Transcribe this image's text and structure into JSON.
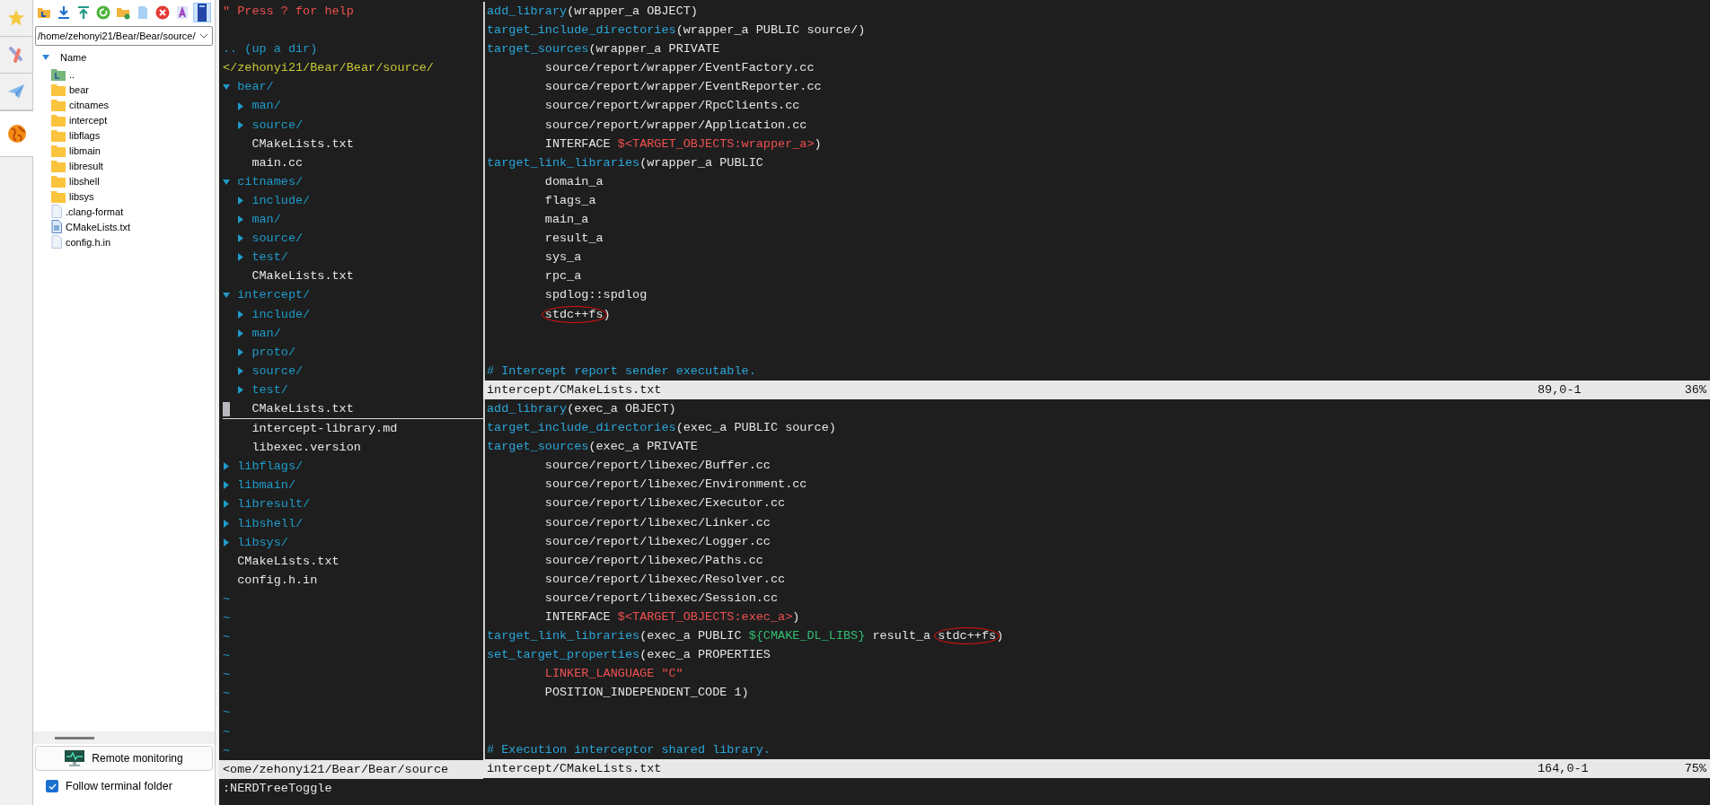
{
  "sidebar": {
    "tabs": [
      {
        "kind": "star",
        "selected": false
      },
      {
        "kind": "tool",
        "selected": false
      },
      {
        "kind": "plane",
        "selected": false
      },
      {
        "kind": "globe",
        "selected": true
      }
    ],
    "toolbar": [
      {
        "kind": "folder-up",
        "on": false
      },
      {
        "kind": "download",
        "on": false
      },
      {
        "kind": "upload",
        "on": false
      },
      {
        "kind": "refresh",
        "on": false
      },
      {
        "kind": "new-folder",
        "on": false
      },
      {
        "kind": "new-file",
        "on": false
      },
      {
        "kind": "close",
        "on": false
      },
      {
        "kind": "font",
        "on": false
      },
      {
        "kind": "panel",
        "on": true
      }
    ],
    "path": "/home/zehonyi21/Bear/Bear/source/",
    "files": {
      "header": "Name",
      "items": [
        {
          "kind": "up",
          "name": ".."
        },
        {
          "kind": "folder",
          "name": "bear"
        },
        {
          "kind": "folder",
          "name": "citnames"
        },
        {
          "kind": "folder",
          "name": "intercept"
        },
        {
          "kind": "folder",
          "name": "libflags"
        },
        {
          "kind": "folder",
          "name": "libmain"
        },
        {
          "kind": "folder",
          "name": "libresult"
        },
        {
          "kind": "folder",
          "name": "libshell"
        },
        {
          "kind": "folder",
          "name": "libsys"
        },
        {
          "kind": "file",
          "name": ".clang-format"
        },
        {
          "kind": "text",
          "name": "CMakeLists.txt"
        },
        {
          "kind": "file",
          "name": "config.h.in"
        }
      ]
    },
    "remote_button": "Remote monitoring",
    "follow": {
      "label": "Follow terminal folder",
      "checked": true
    }
  },
  "vim": {
    "tree": {
      "help": "\" Press ? for help",
      "up": ".. (up a dir)",
      "root": "</zehonyi21/Bear/Bear/source/",
      "entries": [
        {
          "kind": "dir",
          "name": "bear/",
          "expanded": true,
          "children": [
            {
              "kind": "dir",
              "name": "man/",
              "expanded": false
            },
            {
              "kind": "dir",
              "name": "source/",
              "expanded": false
            },
            {
              "kind": "file",
              "name": "CMakeLists.txt"
            },
            {
              "kind": "file",
              "name": "main.cc"
            }
          ]
        },
        {
          "kind": "dir",
          "name": "citnames/",
          "expanded": true,
          "children": [
            {
              "kind": "dir",
              "name": "include/",
              "expanded": false
            },
            {
              "kind": "dir",
              "name": "man/",
              "expanded": false
            },
            {
              "kind": "dir",
              "name": "source/",
              "expanded": false
            },
            {
              "kind": "dir",
              "name": "test/",
              "expanded": false
            },
            {
              "kind": "file",
              "name": "CMakeLists.txt"
            }
          ]
        },
        {
          "kind": "dir",
          "name": "intercept/",
          "expanded": true,
          "children": [
            {
              "kind": "dir",
              "name": "include/",
              "expanded": false
            },
            {
              "kind": "dir",
              "name": "man/",
              "expanded": false
            },
            {
              "kind": "dir",
              "name": "proto/",
              "expanded": false
            },
            {
              "kind": "dir",
              "name": "source/",
              "expanded": false
            },
            {
              "kind": "dir",
              "name": "test/",
              "expanded": false
            },
            {
              "kind": "file",
              "name": "CMakeLists.txt",
              "selected": true
            },
            {
              "kind": "file",
              "name": "intercept-library.md"
            },
            {
              "kind": "file",
              "name": "libexec.version"
            }
          ]
        },
        {
          "kind": "dir",
          "name": "libflags/",
          "expanded": false
        },
        {
          "kind": "dir",
          "name": "libmain/",
          "expanded": false
        },
        {
          "kind": "dir",
          "name": "libresult/",
          "expanded": false
        },
        {
          "kind": "dir",
          "name": "libshell/",
          "expanded": false
        },
        {
          "kind": "dir",
          "name": "libsys/",
          "expanded": false
        },
        {
          "kind": "file",
          "name": "CMakeLists.txt"
        },
        {
          "kind": "file",
          "name": "config.h.in"
        }
      ],
      "filler": [
        "~",
        "~",
        "~",
        "~",
        "~",
        "~",
        "~",
        "~",
        "~"
      ],
      "status": "<ome/zehonyi21/Bear/Bear/source"
    },
    "windows": [
      {
        "lines": [
          {
            "kind": "code",
            "segments": [
              {
                "kind": "func",
                "text": "add_library"
              },
              {
                "kind": "plain",
                "text": "(wrapper_a OBJECT)"
              }
            ]
          },
          {
            "kind": "code",
            "segments": [
              {
                "kind": "func",
                "text": "target_include_directories"
              },
              {
                "kind": "plain",
                "text": "(wrapper_a PUBLIC source/)"
              }
            ]
          },
          {
            "kind": "code",
            "segments": [
              {
                "kind": "func",
                "text": "target_sources"
              },
              {
                "kind": "plain",
                "text": "(wrapper_a PRIVATE"
              }
            ]
          },
          {
            "kind": "code",
            "segments": [
              {
                "kind": "plain",
                "text": "        source/report/wrapper/EventFactory.cc"
              }
            ]
          },
          {
            "kind": "code",
            "segments": [
              {
                "kind": "plain",
                "text": "        source/report/wrapper/EventReporter.cc"
              }
            ]
          },
          {
            "kind": "code",
            "segments": [
              {
                "kind": "plain",
                "text": "        source/report/wrapper/RpcClients.cc"
              }
            ]
          },
          {
            "kind": "code",
            "segments": [
              {
                "kind": "plain",
                "text": "        source/report/wrapper/Application.cc"
              }
            ]
          },
          {
            "kind": "code",
            "segments": [
              {
                "kind": "plain",
                "text": "        INTERFACE "
              },
              {
                "kind": "var",
                "text": "$<TARGET_OBJECTS:wrapper_a>"
              },
              {
                "kind": "plain",
                "text": ")"
              }
            ]
          },
          {
            "kind": "code",
            "segments": [
              {
                "kind": "func",
                "text": "target_link_libraries"
              },
              {
                "kind": "plain",
                "text": "(wrapper_a PUBLIC"
              }
            ]
          },
          {
            "kind": "code",
            "segments": [
              {
                "kind": "plain",
                "text": "        domain_a"
              }
            ]
          },
          {
            "kind": "code",
            "segments": [
              {
                "kind": "plain",
                "text": "        flags_a"
              }
            ]
          },
          {
            "kind": "code",
            "segments": [
              {
                "kind": "plain",
                "text": "        main_a"
              }
            ]
          },
          {
            "kind": "code",
            "segments": [
              {
                "kind": "plain",
                "text": "        result_a"
              }
            ]
          },
          {
            "kind": "code",
            "segments": [
              {
                "kind": "plain",
                "text": "        sys_a"
              }
            ]
          },
          {
            "kind": "code",
            "segments": [
              {
                "kind": "plain",
                "text": "        rpc_a"
              }
            ]
          },
          {
            "kind": "code",
            "segments": [
              {
                "kind": "plain",
                "text": "        spdlog::spdlog"
              }
            ]
          },
          {
            "kind": "code",
            "indented": true,
            "segments": [
              {
                "kind": "plain",
                "text": "stdc++fs",
                "circled": true
              },
              {
                "kind": "plain",
                "text": ")"
              }
            ]
          },
          {
            "kind": "blank"
          },
          {
            "kind": "blank"
          },
          {
            "kind": "code",
            "segments": [
              {
                "kind": "comment",
                "text": "# Intercept report sender executable."
              }
            ]
          }
        ],
        "status": {
          "file": "intercept/CMakeLists.txt",
          "position": "89,0-1",
          "percent": "36%"
        }
      },
      {
        "lines": [
          {
            "kind": "code",
            "segments": [
              {
                "kind": "func",
                "text": "add_library"
              },
              {
                "kind": "plain",
                "text": "(exec_a OBJECT)"
              }
            ]
          },
          {
            "kind": "code",
            "segments": [
              {
                "kind": "func",
                "text": "target_include_directories"
              },
              {
                "kind": "plain",
                "text": "(exec_a PUBLIC source)"
              }
            ]
          },
          {
            "kind": "code",
            "segments": [
              {
                "kind": "func",
                "text": "target_sources"
              },
              {
                "kind": "plain",
                "text": "(exec_a PRIVATE"
              }
            ]
          },
          {
            "kind": "code",
            "segments": [
              {
                "kind": "plain",
                "text": "        source/report/libexec/Buffer.cc"
              }
            ]
          },
          {
            "kind": "code",
            "segments": [
              {
                "kind": "plain",
                "text": "        source/report/libexec/Environment.cc"
              }
            ]
          },
          {
            "kind": "code",
            "segments": [
              {
                "kind": "plain",
                "text": "        source/report/libexec/Executor.cc"
              }
            ]
          },
          {
            "kind": "code",
            "segments": [
              {
                "kind": "plain",
                "text": "        source/report/libexec/Linker.cc"
              }
            ]
          },
          {
            "kind": "code",
            "segments": [
              {
                "kind": "plain",
                "text": "        source/report/libexec/Logger.cc"
              }
            ]
          },
          {
            "kind": "code",
            "segments": [
              {
                "kind": "plain",
                "text": "        source/report/libexec/Paths.cc"
              }
            ]
          },
          {
            "kind": "code",
            "segments": [
              {
                "kind": "plain",
                "text": "        source/report/libexec/Resolver.cc"
              }
            ]
          },
          {
            "kind": "code",
            "segments": [
              {
                "kind": "plain",
                "text": "        source/report/libexec/Session.cc"
              }
            ]
          },
          {
            "kind": "code",
            "segments": [
              {
                "kind": "plain",
                "text": "        INTERFACE "
              },
              {
                "kind": "var",
                "text": "$<TARGET_OBJECTS:exec_a>"
              },
              {
                "kind": "plain",
                "text": ")"
              }
            ]
          },
          {
            "kind": "code",
            "segments": [
              {
                "kind": "func",
                "text": "target_link_libraries"
              },
              {
                "kind": "plain",
                "text": "(exec_a PUBLIC "
              },
              {
                "kind": "env",
                "text": "${CMAKE_DL_LIBS}"
              },
              {
                "kind": "plain",
                "text": " result_a "
              },
              {
                "kind": "plain",
                "text": "stdc++fs",
                "circled": true
              },
              {
                "kind": "plain",
                "text": ")"
              }
            ]
          },
          {
            "kind": "code",
            "segments": [
              {
                "kind": "func",
                "text": "set_target_properties"
              },
              {
                "kind": "plain",
                "text": "(exec_a PROPERTIES"
              }
            ]
          },
          {
            "kind": "code",
            "indented": true,
            "segments": [
              {
                "kind": "var",
                "text": "LINKER_LANGUAGE \"C\""
              }
            ]
          },
          {
            "kind": "code",
            "segments": [
              {
                "kind": "plain",
                "text": "        POSITION_INDEPENDENT_CODE 1)"
              }
            ]
          },
          {
            "kind": "blank"
          },
          {
            "kind": "blank"
          },
          {
            "kind": "code",
            "segments": [
              {
                "kind": "comment",
                "text": "# Execution interceptor shared library."
              }
            ]
          }
        ],
        "status": {
          "file": "intercept/CMakeLists.txt",
          "position": "164,0-1",
          "percent": "75%"
        }
      }
    ],
    "command": ":NERDTreeToggle"
  }
}
